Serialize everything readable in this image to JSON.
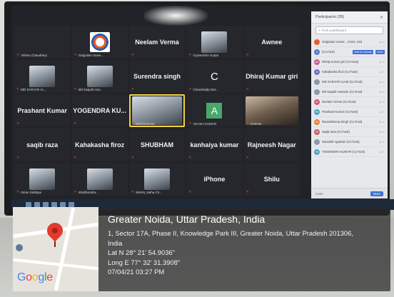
{
  "meeting": {
    "tiles": [
      {
        "type": "label",
        "small": "Vishnu Chaudhary"
      },
      {
        "type": "logo",
        "small": "Galgotias Unive..."
      },
      {
        "type": "name",
        "name": "Neelam Verma"
      },
      {
        "type": "cam",
        "small": "Gyanendra Gupta"
      },
      {
        "type": "name",
        "name": "Awnee"
      },
      {
        "type": "cam",
        "small": "MD SARJAR AL..."
      },
      {
        "type": "cam",
        "small": "Md Saquib Hus..."
      },
      {
        "type": "name",
        "name": "Surendra singh"
      },
      {
        "type": "letter",
        "letter": "C",
        "style": "plain",
        "small": "Chandradip Nat..."
      },
      {
        "type": "name",
        "name": "Dhiraj Kumar giri"
      },
      {
        "type": "name",
        "name": "Prashant Kumar"
      },
      {
        "type": "name",
        "name": "YOGENDRA KU..."
      },
      {
        "type": "cam-active",
        "small": "Wali Rehman"
      },
      {
        "type": "letter",
        "letter": "A",
        "style": "green",
        "small": "AKASH KUMAR"
      },
      {
        "type": "wide",
        "small": "KARAN"
      },
      {
        "type": "name",
        "name": "saqib raza"
      },
      {
        "type": "name",
        "name": "Kahakasha firoz"
      },
      {
        "type": "name",
        "name": "SHUBHAM"
      },
      {
        "type": "name",
        "name": "kanhaiya kumar"
      },
      {
        "type": "name",
        "name": "Rajneesh Nagar"
      },
      {
        "type": "cam",
        "small": "Imran Siddiqui"
      },
      {
        "type": "cam",
        "small": "Shahbendra..."
      },
      {
        "type": "cam",
        "small": "SMAN_Neha Ch..."
      },
      {
        "type": "name",
        "name": "iPhone"
      },
      {
        "type": "name",
        "name": "Shilu"
      }
    ]
  },
  "participants": {
    "title": "Participants (39)",
    "search_placeholder": "Find a participant",
    "add_to_domain": "Add to Domain",
    "more_label": "More",
    "invite_label": "Invite",
    "footer_more": "More",
    "rows": [
      {
        "initials": "",
        "name": "Galgotias Univer... (Host, me)",
        "color": "#e65c2c"
      },
      {
        "initials": "A",
        "name": "(Co-host)",
        "color": "#4e7fc4",
        "has_button": true
      },
      {
        "initials": "DK",
        "name": "Dhiraj Kumar giri (Co-host)",
        "color": "#c65b8a"
      },
      {
        "initials": "K",
        "name": "Kahakasha firoz (Co-host)",
        "color": "#7a6fc4"
      },
      {
        "initials": "",
        "name": "MD SARJAR ALAM (Co-host)",
        "color": "#8a9aa8"
      },
      {
        "initials": "",
        "name": "Md Saquib Hussain (Co-host)",
        "color": "#8a9aa8"
      },
      {
        "initials": "NV",
        "name": "Neelam Verma (Co-host)",
        "color": "#d0566a"
      },
      {
        "initials": "PK",
        "name": "Prashant Kumar (Co-host)",
        "color": "#4fa3c4"
      },
      {
        "initials": "RS",
        "name": "RaunakDeep Singh (Co-host)",
        "color": "#e27f3a"
      },
      {
        "initials": "SR",
        "name": "saqib raza (Co-host)",
        "color": "#c45d5d"
      },
      {
        "initials": "",
        "name": "Saurabh Agrahari (Co-host)",
        "color": "#8a9aa8"
      },
      {
        "initials": "YK",
        "name": "YOGENDRA KUMAR (Co-host)",
        "color": "#4fa3c4"
      }
    ]
  },
  "geotag": {
    "title": "Greater Noida, Uttar Pradesh, India",
    "address_line1": "1, Sector 17A, Phase II, Knowledge Park III, Greater Noida, Uttar Pradesh 201306,",
    "address_line2": "India",
    "lat": "Lat N 28° 21' 54.9036\"",
    "long": "Long E 77° 32' 31.3908\"",
    "datetime": "07/04/21 03:27 PM",
    "map_brand": "Google"
  },
  "colors": {
    "pin": "#e23a2e",
    "active_border": "#f2d33a",
    "accent_blue": "#3c6fd6"
  }
}
